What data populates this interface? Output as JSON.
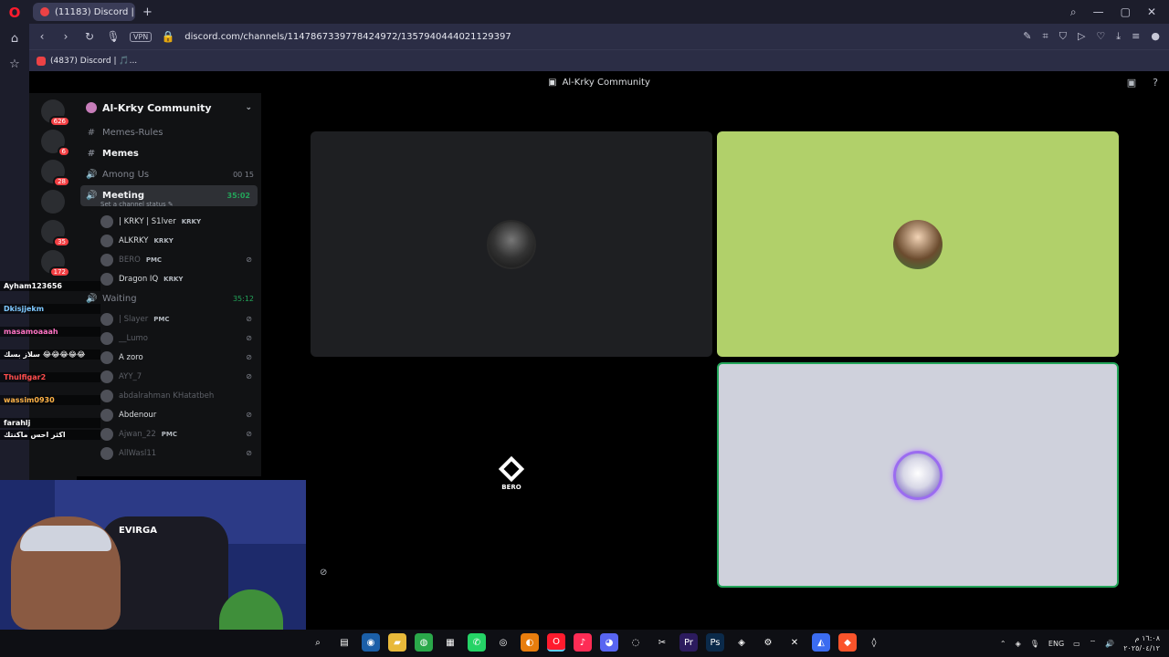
{
  "browser": {
    "tabs": [
      {
        "label": "(11183) Discord | ج..."
      }
    ],
    "new_tab_label": "+",
    "url": "discord.com/channels/1147867339778424972/1357940444021129397",
    "vpn_label": "VPN",
    "bookmarks": [
      {
        "label": "(4837) Discord | 🎵..."
      }
    ]
  },
  "discord": {
    "window_title": "Al-Krky Community",
    "server": {
      "name": "Al-Krky Community"
    },
    "guild_badges": [
      "626",
      "6",
      "28",
      "",
      "35",
      "172"
    ],
    "channels": [
      {
        "icon": "#",
        "name": "Memes-Rules",
        "style": "muted"
      },
      {
        "icon": "#",
        "name": "Memes",
        "style": "bold"
      },
      {
        "icon": "🔊",
        "name": "Among Us",
        "style": "muted",
        "right": "00  15"
      },
      {
        "icon": "🔊",
        "name": "Meeting",
        "style": "active",
        "right": "35:02"
      }
    ],
    "meeting_status": "Set a channel status ✎",
    "meeting_members": [
      {
        "name": "| KRKY | S1lver",
        "tag": "KRKY",
        "dim": false
      },
      {
        "name": "ALKRKY",
        "tag": "KRKY",
        "dim": false
      },
      {
        "name": "BERO",
        "tag": "PMC",
        "dim": true
      },
      {
        "name": "Dragon IQ",
        "tag": "KRKY",
        "dim": false
      }
    ],
    "waiting_channel": {
      "icon": "🔊",
      "name": "Waiting",
      "right": "35:12"
    },
    "waiting_members": [
      {
        "name": "| Slayer",
        "tag": "PMC",
        "dim": true
      },
      {
        "name": "__Lumo",
        "tag": "",
        "dim": true
      },
      {
        "name": "A zoro",
        "tag": "",
        "dim": false
      },
      {
        "name": "AYY_7",
        "tag": "",
        "dim": true
      },
      {
        "name": "abdalrahman KHatatbeh",
        "tag": "",
        "dim": true
      },
      {
        "name": "Abdenour",
        "tag": "",
        "dim": false
      },
      {
        "name": "Ajwan_22",
        "tag": "PMC",
        "dim": true
      },
      {
        "name": "AllWasl11",
        "tag": "",
        "dim": true
      }
    ],
    "stage": {
      "tile3_label": "BERO"
    }
  },
  "overlay": {
    "names": [
      {
        "name": "Ayham123656",
        "color": "white"
      },
      {
        "name": "Dkisjjekm",
        "color": "blue"
      },
      {
        "name": "masamoaaah",
        "color": "pink"
      },
      {
        "name": "سلاز بسك 😂😂😂😂😂",
        "color": "white"
      },
      {
        "name": "Thulfigar2",
        "color": "red"
      },
      {
        "name": "wassim0930",
        "color": "orange"
      },
      {
        "name": "farahlj",
        "color": "white"
      },
      {
        "name": "اكثر احس ماكنتك",
        "color": "white"
      }
    ]
  },
  "webcam": {
    "brand": "EVIRGA"
  },
  "taskbar": {
    "apps": [
      "search-icon",
      "task-view-icon",
      "steam-icon",
      "files-icon",
      "chrome-icon",
      "photos-icon",
      "whatsapp-icon",
      "obs-icon",
      "blender-icon",
      "opera-icon",
      "tiktok-icon",
      "discord-icon",
      "app-icon",
      "capcut-icon",
      "premiere-icon",
      "photoshop-icon",
      "game-icon",
      "settings-icon",
      "x-icon",
      "arc-icon",
      "brave-icon",
      "vpn-icon"
    ],
    "lang": "ENG",
    "time": "١٦:٠٨ م",
    "date": "٢٠٢٥/٠٤/١٢"
  },
  "colors": {
    "discord_green": "#23a55a",
    "tile2_bg": "#b1d06a",
    "tile4_bg": "#cfd1dc",
    "opera_red": "#ff1b2d"
  }
}
